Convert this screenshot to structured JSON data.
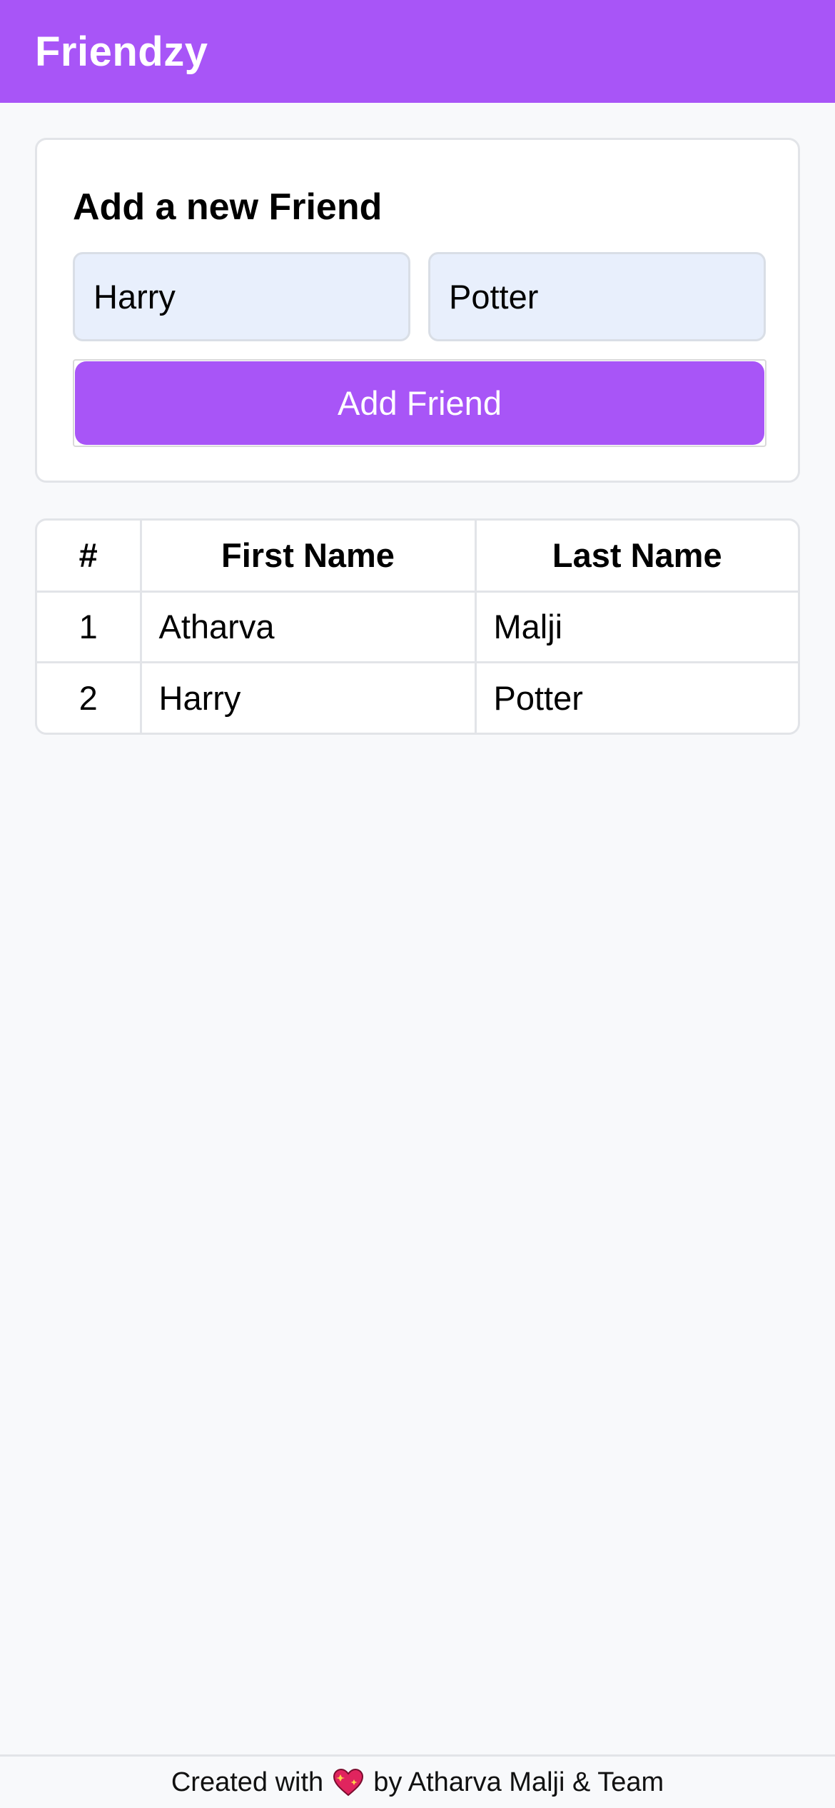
{
  "navbar": {
    "brand": "Friendzy",
    "color": "#a855f7"
  },
  "form": {
    "title": "Add a new Friend",
    "first_name_value": "Harry",
    "last_name_value": "Potter",
    "submit_label": "Add Friend"
  },
  "table": {
    "headers": [
      "#",
      "First Name",
      "Last Name"
    ],
    "rows": [
      {
        "index": "1",
        "first": "Atharva",
        "last": "Malji"
      },
      {
        "index": "2",
        "first": "Harry",
        "last": "Potter"
      }
    ]
  },
  "footer": {
    "prefix": "Created with",
    "icon": "sparkling-heart-icon",
    "suffix": "by Atharva Malji & Team"
  }
}
